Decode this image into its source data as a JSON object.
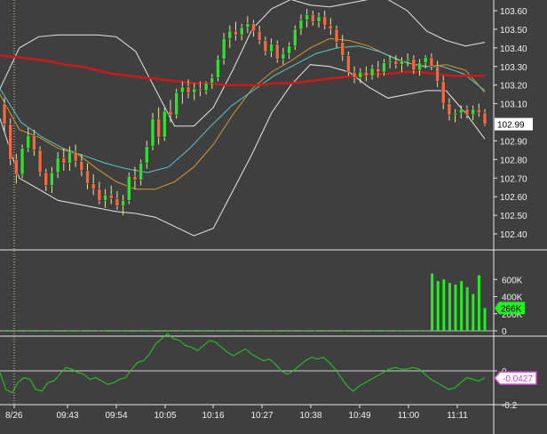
{
  "colors": {
    "background": "#3f3f3f",
    "panel_border": "#e8e8e8",
    "bollinger": "#e6e6e6",
    "ma_long": "#cc1a1a",
    "ma_orange": "#d79a2a",
    "ma_teal": "#5ec6c6",
    "candle_up": "#33dd33",
    "candle_down": "#ee6a40",
    "volume": "#22ee22",
    "oscillator": "#22cc22",
    "price_tag": "#ffffff",
    "volume_tag": "#22ee22",
    "osc_tag": "#cc44cc"
  },
  "chart_data": [
    {
      "type": "candlestick",
      "panel": "price",
      "ylim": [
        102.34,
        103.64
      ],
      "yticks": [
        "103.60",
        "103.50",
        "103.40",
        "103.30",
        "103.20",
        "103.10",
        "102.90",
        "102.80",
        "102.70",
        "102.60",
        "102.50",
        "102.40"
      ],
      "last_price_label": "102.99",
      "x_labels": [
        "8/26",
        "09:43",
        "09:54",
        "10:05",
        "10:16",
        "10:27",
        "10:38",
        "10:49",
        "11:00",
        "11:11"
      ],
      "ohlc": [
        [
          103.1,
          103.13,
          102.95,
          102.99
        ],
        [
          102.99,
          103.02,
          102.77,
          102.8
        ],
        [
          102.8,
          102.83,
          102.67,
          102.72
        ],
        [
          102.72,
          102.88,
          102.7,
          102.86
        ],
        [
          102.86,
          102.97,
          102.84,
          102.93
        ],
        [
          102.93,
          102.96,
          102.82,
          102.85
        ],
        [
          102.85,
          102.87,
          102.71,
          102.73
        ],
        [
          102.73,
          102.75,
          102.63,
          102.66
        ],
        [
          102.66,
          102.76,
          102.62,
          102.73
        ],
        [
          102.73,
          102.84,
          102.7,
          102.81
        ],
        [
          102.81,
          102.86,
          102.74,
          102.78
        ],
        [
          102.78,
          102.87,
          102.74,
          102.84
        ],
        [
          102.84,
          102.88,
          102.76,
          102.79
        ],
        [
          102.79,
          102.83,
          102.71,
          102.74
        ],
        [
          102.74,
          102.78,
          102.64,
          102.67
        ],
        [
          102.67,
          102.72,
          102.61,
          102.64
        ],
        [
          102.64,
          102.68,
          102.56,
          102.58
        ],
        [
          102.58,
          102.64,
          102.54,
          102.61
        ],
        [
          102.61,
          102.66,
          102.56,
          102.59
        ],
        [
          102.59,
          102.63,
          102.53,
          102.55
        ],
        [
          102.55,
          102.61,
          102.5,
          102.58
        ],
        [
          102.58,
          102.73,
          102.56,
          102.71
        ],
        [
          102.71,
          102.76,
          102.64,
          102.69
        ],
        [
          102.69,
          102.8,
          102.66,
          102.78
        ],
        [
          102.78,
          102.9,
          102.75,
          102.87
        ],
        [
          102.87,
          103.05,
          102.85,
          103.02
        ],
        [
          103.02,
          103.08,
          102.88,
          102.92
        ],
        [
          102.92,
          103.08,
          102.9,
          103.06
        ],
        [
          103.06,
          103.12,
          103.0,
          103.04
        ],
        [
          103.04,
          103.18,
          103.02,
          103.16
        ],
        [
          103.16,
          103.22,
          103.1,
          103.19
        ],
        [
          103.19,
          103.23,
          103.13,
          103.16
        ],
        [
          103.16,
          103.21,
          103.12,
          103.18
        ],
        [
          103.18,
          103.22,
          103.14,
          103.17
        ],
        [
          103.17,
          103.22,
          103.15,
          103.21
        ],
        [
          103.21,
          103.26,
          103.18,
          103.24
        ],
        [
          103.24,
          103.36,
          103.22,
          103.34
        ],
        [
          103.34,
          103.48,
          103.31,
          103.45
        ],
        [
          103.45,
          103.52,
          103.4,
          103.49
        ],
        [
          103.49,
          103.54,
          103.44,
          103.47
        ],
        [
          103.47,
          103.53,
          103.44,
          103.51
        ],
        [
          103.51,
          103.57,
          103.48,
          103.53
        ],
        [
          103.53,
          103.55,
          103.46,
          103.49
        ],
        [
          103.49,
          103.52,
          103.42,
          103.44
        ],
        [
          103.44,
          103.46,
          103.36,
          103.38
        ],
        [
          103.38,
          103.45,
          103.35,
          103.42
        ],
        [
          103.42,
          103.44,
          103.32,
          103.34
        ],
        [
          103.34,
          103.4,
          103.31,
          103.37
        ],
        [
          103.37,
          103.43,
          103.34,
          103.41
        ],
        [
          103.41,
          103.52,
          103.39,
          103.5
        ],
        [
          103.5,
          103.58,
          103.47,
          103.55
        ],
        [
          103.55,
          103.61,
          103.51,
          103.58
        ],
        [
          103.58,
          103.6,
          103.52,
          103.54
        ],
        [
          103.54,
          103.59,
          103.51,
          103.57
        ],
        [
          103.57,
          103.6,
          103.5,
          103.52
        ],
        [
          103.52,
          103.56,
          103.47,
          103.5
        ],
        [
          103.5,
          103.52,
          103.4,
          103.43
        ],
        [
          103.43,
          103.47,
          103.33,
          103.36
        ],
        [
          103.36,
          103.38,
          103.25,
          103.27
        ],
        [
          103.27,
          103.3,
          103.21,
          103.24
        ],
        [
          103.24,
          103.29,
          103.21,
          103.27
        ],
        [
          103.27,
          103.3,
          103.22,
          103.25
        ],
        [
          103.25,
          103.31,
          103.23,
          103.29
        ],
        [
          103.29,
          103.33,
          103.24,
          103.27
        ],
        [
          103.27,
          103.34,
          103.25,
          103.32
        ],
        [
          103.32,
          103.36,
          103.29,
          103.33
        ],
        [
          103.33,
          103.36,
          103.29,
          103.31
        ],
        [
          103.31,
          103.35,
          103.27,
          103.33
        ],
        [
          103.33,
          103.37,
          103.3,
          103.34
        ],
        [
          103.34,
          103.36,
          103.26,
          103.28
        ],
        [
          103.28,
          103.34,
          103.25,
          103.32
        ],
        [
          103.32,
          103.36,
          103.29,
          103.35
        ],
        [
          103.35,
          103.37,
          103.28,
          103.3
        ],
        [
          103.3,
          103.33,
          103.19,
          103.22
        ],
        [
          103.22,
          103.25,
          103.07,
          103.1
        ],
        [
          103.1,
          103.13,
          103.01,
          103.04
        ],
        [
          103.04,
          103.07,
          103.0,
          103.05
        ],
        [
          103.05,
          103.09,
          103.02,
          103.07
        ],
        [
          103.07,
          103.09,
          103.02,
          103.04
        ],
        [
          103.04,
          103.09,
          103.01,
          103.07
        ],
        [
          103.07,
          103.1,
          103.03,
          103.05
        ],
        [
          103.05,
          103.07,
          102.98,
          102.99
        ]
      ],
      "ma_long": [
        103.36,
        103.35,
        103.34,
        103.33,
        103.31,
        103.3,
        103.28,
        103.26,
        103.25,
        103.24,
        103.23,
        103.22,
        103.21,
        103.21,
        103.2,
        103.2,
        103.2,
        103.21,
        103.21,
        103.22,
        103.23,
        103.24,
        103.25,
        103.26,
        103.26,
        103.27,
        103.27,
        103.26,
        103.25,
        103.25,
        103.25
      ],
      "upper_band": [
        103.18,
        103.4,
        103.46,
        103.47,
        103.47,
        103.47,
        103.46,
        103.38,
        103.18,
        102.98,
        102.98,
        103.08,
        103.28,
        103.5,
        103.61,
        103.66,
        103.63,
        103.62,
        103.64,
        103.66,
        103.66,
        103.6,
        103.49,
        103.44,
        103.41,
        103.43
      ],
      "lower_band": [
        103.02,
        102.7,
        102.64,
        102.58,
        102.56,
        102.54,
        102.52,
        102.51,
        102.49,
        102.44,
        102.39,
        102.43,
        102.63,
        102.83,
        103.05,
        103.2,
        103.31,
        103.3,
        103.27,
        103.19,
        103.13,
        103.15,
        103.17,
        103.17,
        103.05,
        102.91
      ],
      "ma_orange": [
        103.15,
        102.96,
        102.92,
        102.86,
        102.83,
        102.75,
        102.68,
        102.64,
        102.64,
        102.68,
        102.76,
        102.88,
        103.04,
        103.18,
        103.27,
        103.33,
        103.4,
        103.45,
        103.44,
        103.41,
        103.36,
        103.32,
        103.3,
        103.31,
        103.28,
        103.16
      ],
      "ma_teal": [
        103.18,
        103.0,
        102.92,
        102.86,
        102.82,
        102.78,
        102.75,
        102.73,
        102.76,
        102.86,
        102.98,
        103.09,
        103.17,
        103.25,
        103.31,
        103.37,
        103.4,
        103.41,
        103.38,
        103.33,
        103.3,
        103.3,
        103.26,
        103.17
      ]
    },
    {
      "type": "bar",
      "panel": "volume",
      "ylim": [
        0,
        800000
      ],
      "yticks": [
        "600K",
        "400K",
        "200K",
        "0"
      ],
      "last_value_label": "266K",
      "values": [
        4000,
        3000,
        5000,
        2000,
        6000,
        3000,
        4000,
        2000,
        5000,
        3000,
        2000,
        4000,
        3000,
        5000,
        2000,
        3000,
        6000,
        4000,
        2000,
        3000,
        5000,
        3000,
        2000,
        4000,
        3000,
        5000,
        2000,
        3000,
        4000,
        2000,
        6000,
        3000,
        5000,
        2000,
        4000,
        3000,
        5000,
        2000,
        3000,
        4000,
        2000,
        5000,
        3000,
        2000,
        4000,
        3000,
        5000,
        2000,
        3000,
        4000,
        2000,
        6000,
        3000,
        5000,
        2000,
        4000,
        3000,
        2000,
        5000,
        3000,
        2000,
        4000,
        3000,
        5000,
        2000,
        4000,
        3000,
        5000,
        4000,
        3000,
        2000,
        4000,
        5000,
        670000,
        580000,
        600000,
        560000,
        540000,
        580000,
        510000,
        430000,
        650000,
        266000
      ]
    },
    {
      "type": "line",
      "panel": "oscillator",
      "ylim": [
        -0.22,
        0.55
      ],
      "yticks": [
        "0",
        "-0.2"
      ],
      "last_value_label": "-0.0427",
      "values": [
        -0.01,
        -0.11,
        -0.13,
        -0.07,
        -0.04,
        -0.05,
        -0.11,
        -0.12,
        -0.07,
        -0.06,
        -0.02,
        0.02,
        0.01,
        -0.01,
        -0.02,
        -0.05,
        -0.04,
        -0.06,
        -0.08,
        -0.07,
        -0.05,
        -0.04,
        0.01,
        0.05,
        0.06,
        0.1,
        0.16,
        0.19,
        0.22,
        0.19,
        0.18,
        0.15,
        0.14,
        0.12,
        0.15,
        0.18,
        0.17,
        0.14,
        0.11,
        0.09,
        0.11,
        0.13,
        0.1,
        0.08,
        0.06,
        0.07,
        0.04,
        0.0,
        -0.02,
        0.0,
        0.03,
        0.06,
        0.08,
        0.07,
        0.08,
        0.05,
        0.01,
        -0.04,
        -0.09,
        -0.12,
        -0.09,
        -0.07,
        -0.05,
        -0.03,
        -0.01,
        0.01,
        0.02,
        0.01,
        0.01,
        0.02,
        0.01,
        -0.02,
        -0.05,
        -0.07,
        -0.09,
        -0.11,
        -0.1,
        -0.07,
        -0.04,
        -0.05,
        -0.06,
        -0.04
      ]
    }
  ]
}
